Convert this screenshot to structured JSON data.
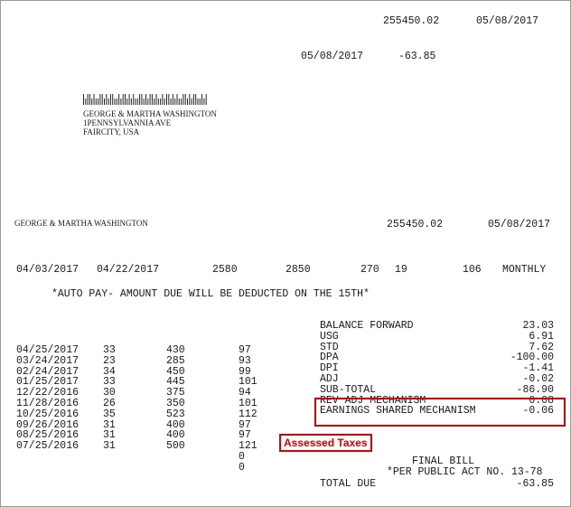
{
  "header": {
    "account_top": "255450.02",
    "date_top": "05/08/2017",
    "date_second": "05/08/2017",
    "amount_second": "-63.85"
  },
  "address": {
    "name": "GEORGE & MARTHA WASHINGTON",
    "street": "1PENNSYLVANNIA AVE",
    "city": "FAIRCITY, USA"
  },
  "account_line": {
    "name": "GEORGE & MARTHA WASHINGTON",
    "account": "255450.02",
    "date": "05/08/2017"
  },
  "period": {
    "from": "04/03/2017",
    "to": "04/22/2017",
    "prev_read": "2580",
    "curr_read": "2850",
    "usage": "270",
    "days": "19",
    "factor": "106",
    "plan": "MONTHLY"
  },
  "notice": "*AUTO PAY- AMOUNT DUE WILL BE DEDUCTED ON THE 15TH*",
  "history": [
    {
      "date": "04/25/2017",
      "days": "33",
      "kwh": "430",
      "avg": "97"
    },
    {
      "date": "03/24/2017",
      "days": "23",
      "kwh": "285",
      "avg": "93"
    },
    {
      "date": "02/24/2017",
      "days": "34",
      "kwh": "450",
      "avg": "99"
    },
    {
      "date": "01/25/2017",
      "days": "33",
      "kwh": "445",
      "avg": "101"
    },
    {
      "date": "12/22/2016",
      "days": "30",
      "kwh": "375",
      "avg": "94"
    },
    {
      "date": "11/28/2016",
      "days": "26",
      "kwh": "350",
      "avg": "101"
    },
    {
      "date": "10/25/2016",
      "days": "35",
      "kwh": "523",
      "avg": "112"
    },
    {
      "date": "09/26/2016",
      "days": "31",
      "kwh": "400",
      "avg": "97"
    },
    {
      "date": "08/25/2016",
      "days": "31",
      "kwh": "400",
      "avg": "97"
    },
    {
      "date": "07/25/2016",
      "days": "31",
      "kwh": "500",
      "avg": "121"
    },
    {
      "date": "",
      "days": "",
      "kwh": "",
      "avg": "0"
    },
    {
      "date": "",
      "days": "",
      "kwh": "",
      "avg": "0"
    }
  ],
  "summary": [
    {
      "label": "BALANCE FORWARD",
      "value": "23.03"
    },
    {
      "label": "USG",
      "value": "6.91"
    },
    {
      "label": "STD",
      "value": "7.62"
    },
    {
      "label": "DPA",
      "value": "-100.00"
    },
    {
      "label": "DPI",
      "value": "-1.41"
    },
    {
      "label": "ADJ",
      "value": "-0.02"
    },
    {
      "label": "SUB-TOTAL",
      "value": "-86.90"
    },
    {
      "label": "REV ADJ MECHANISM",
      "value": "0.08"
    },
    {
      "label": "EARNINGS SHARED MECHANISM",
      "value": "-0.06"
    }
  ],
  "final_bill": "FINAL BILL",
  "public_act": "*PER PUBLIC ACT NO. 13-78",
  "total_due_label": "TOTAL DUE",
  "total_due_value": "-63.85",
  "annotation": {
    "label": "Assessed Taxes",
    "color": "#e00000"
  }
}
